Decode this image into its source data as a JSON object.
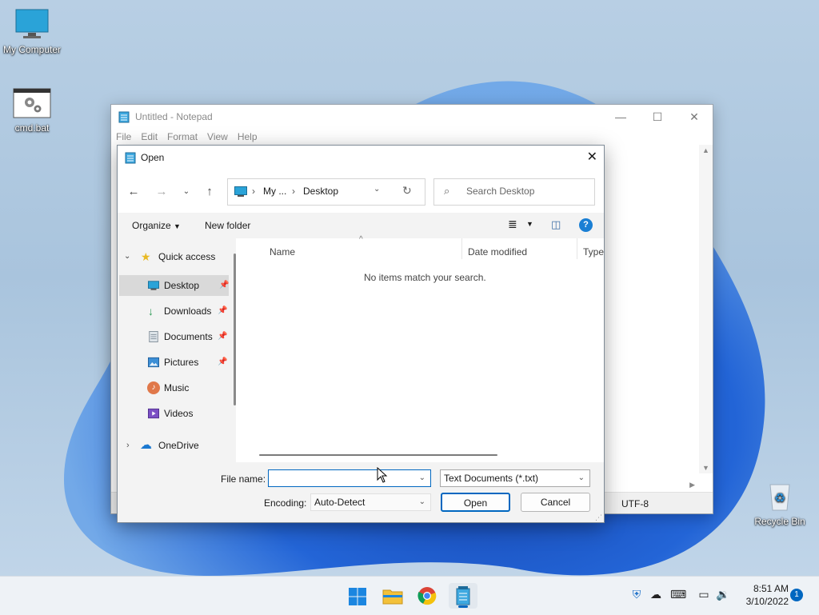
{
  "desktop": {
    "icons": [
      {
        "label": "My Computer"
      },
      {
        "label": "cmd.bat"
      },
      {
        "label": "Recycle Bin"
      }
    ]
  },
  "notepad": {
    "title": "Untitled - Notepad",
    "menu": [
      "File",
      "Edit",
      "Format",
      "View",
      "Help"
    ],
    "status_encoding": "UTF-8"
  },
  "dialog": {
    "title": "Open",
    "breadcrumb": [
      "My ...",
      "Desktop"
    ],
    "search_placeholder": "Search Desktop",
    "toolbar": {
      "organize": "Organize",
      "new_folder": "New folder"
    },
    "nav": {
      "quick_access": "Quick access",
      "items": [
        {
          "label": "Desktop",
          "pinned": true,
          "selected": true
        },
        {
          "label": "Downloads",
          "pinned": true
        },
        {
          "label": "Documents",
          "pinned": true
        },
        {
          "label": "Pictures",
          "pinned": true
        },
        {
          "label": "Music"
        },
        {
          "label": "Videos"
        }
      ],
      "onedrive": "OneDrive"
    },
    "columns": {
      "name": "Name",
      "date_modified": "Date modified",
      "type": "Type"
    },
    "empty_message": "No items match your search.",
    "footer": {
      "file_name_label": "File name:",
      "file_name_value": "",
      "file_type": "Text Documents (*.txt)",
      "encoding_label": "Encoding:",
      "encoding_value": "Auto-Detect",
      "open_button": "Open",
      "cancel_button": "Cancel"
    }
  },
  "taskbar": {
    "time": "8:51 AM",
    "date": "3/10/2022",
    "notification_count": "1"
  },
  "colors": {
    "accent": "#0067c0",
    "folder": "#f3c13a"
  }
}
